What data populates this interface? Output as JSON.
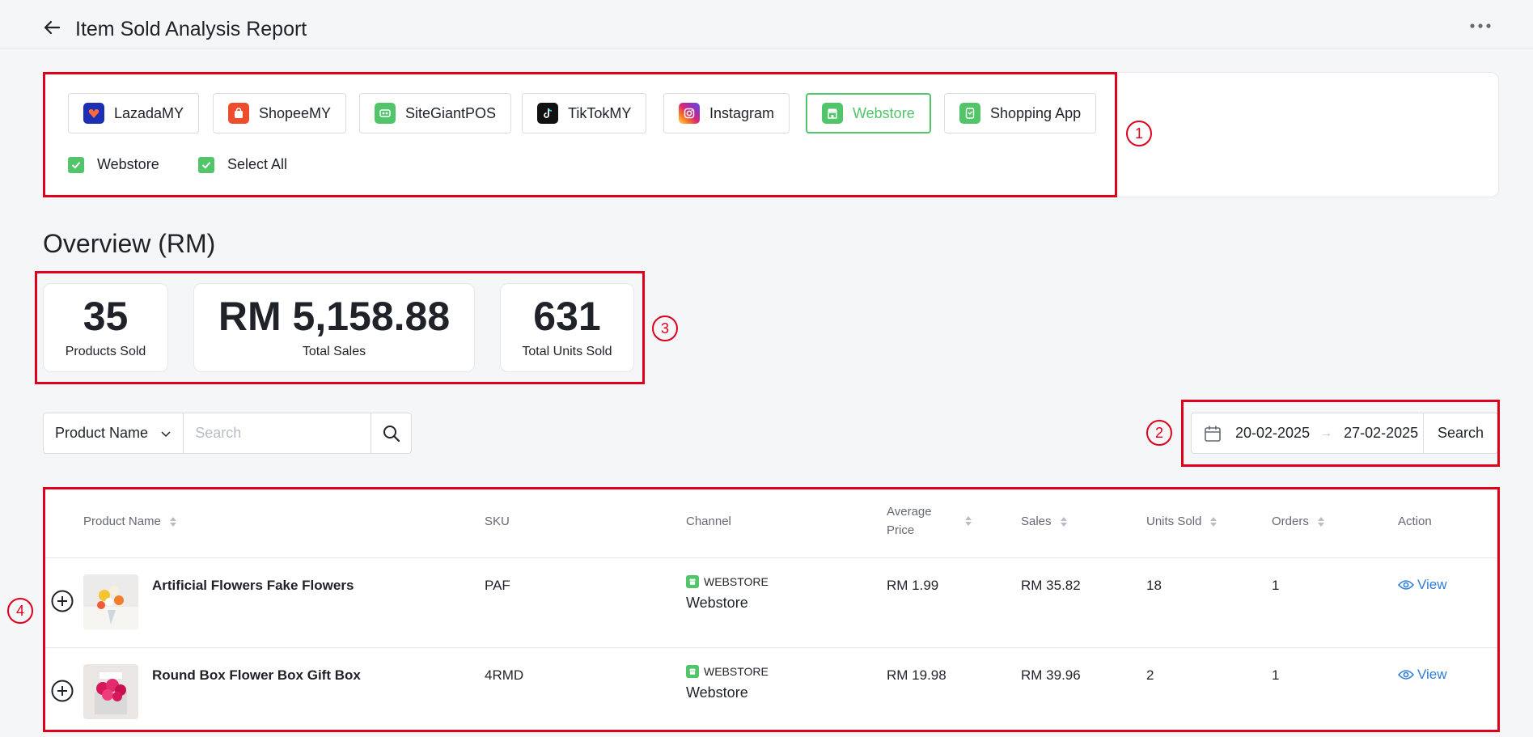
{
  "header": {
    "title": "Item Sold Analysis Report"
  },
  "channels": [
    {
      "label": "LazadaMY",
      "logo": "lazada-icon",
      "color": "#1a2fb3"
    },
    {
      "label": "ShopeeMY",
      "logo": "shopee-icon",
      "color": "#ee4d2d"
    },
    {
      "label": "SiteGiantPOS",
      "logo": "pos-icon",
      "color": "#52c46a"
    },
    {
      "label": "TikTokMY",
      "logo": "tiktok-icon",
      "color": "#111111"
    },
    {
      "label": "Instagram",
      "logo": "instagram-icon",
      "color": "#d62976"
    },
    {
      "label": "Webstore",
      "logo": "webstore-icon",
      "color": "#52c46a",
      "active": true
    },
    {
      "label": "Shopping App",
      "logo": "shopping-app-icon",
      "color": "#52c46a"
    }
  ],
  "checks": [
    {
      "label": "Webstore",
      "checked": true
    },
    {
      "label": "Select All",
      "checked": true
    }
  ],
  "overview": {
    "title": "Overview (RM)",
    "stats": [
      {
        "value": "35",
        "label": "Products Sold"
      },
      {
        "value": "RM 5,158.88",
        "label": "Total Sales"
      },
      {
        "value": "631",
        "label": "Total Units Sold"
      }
    ]
  },
  "filters": {
    "field": "Product Name",
    "search_placeholder": "Search",
    "date_from": "20-02-2025",
    "date_to": "27-02-2025",
    "date_arrow": "→",
    "search_label": "Search"
  },
  "table": {
    "columns": [
      "Product Name",
      "SKU",
      "Channel",
      "Average Price",
      "Sales",
      "Units Sold",
      "Orders",
      "Action"
    ],
    "average_price_line1": "Average",
    "average_price_line2": "Price",
    "rows": [
      {
        "name": "Artificial Flowers Fake Flowers",
        "sku": "PAF",
        "channel_tag": "WEBSTORE",
        "channel": "Webstore",
        "avg_price": "RM 1.99",
        "sales": "RM 35.82",
        "units": "18",
        "orders": "1",
        "action": "View"
      },
      {
        "name": "Round Box Flower Box Gift Box",
        "sku": "4RMD",
        "channel_tag": "WEBSTORE",
        "channel": "Webstore",
        "avg_price": "RM 19.98",
        "sales": "RM 39.96",
        "units": "2",
        "orders": "1",
        "action": "View"
      }
    ]
  },
  "callouts": [
    "1",
    "2",
    "3",
    "4"
  ],
  "colors": {
    "accent_green": "#52c46a",
    "annotation_red": "#e0001b",
    "link_blue": "#2f7dd8"
  }
}
